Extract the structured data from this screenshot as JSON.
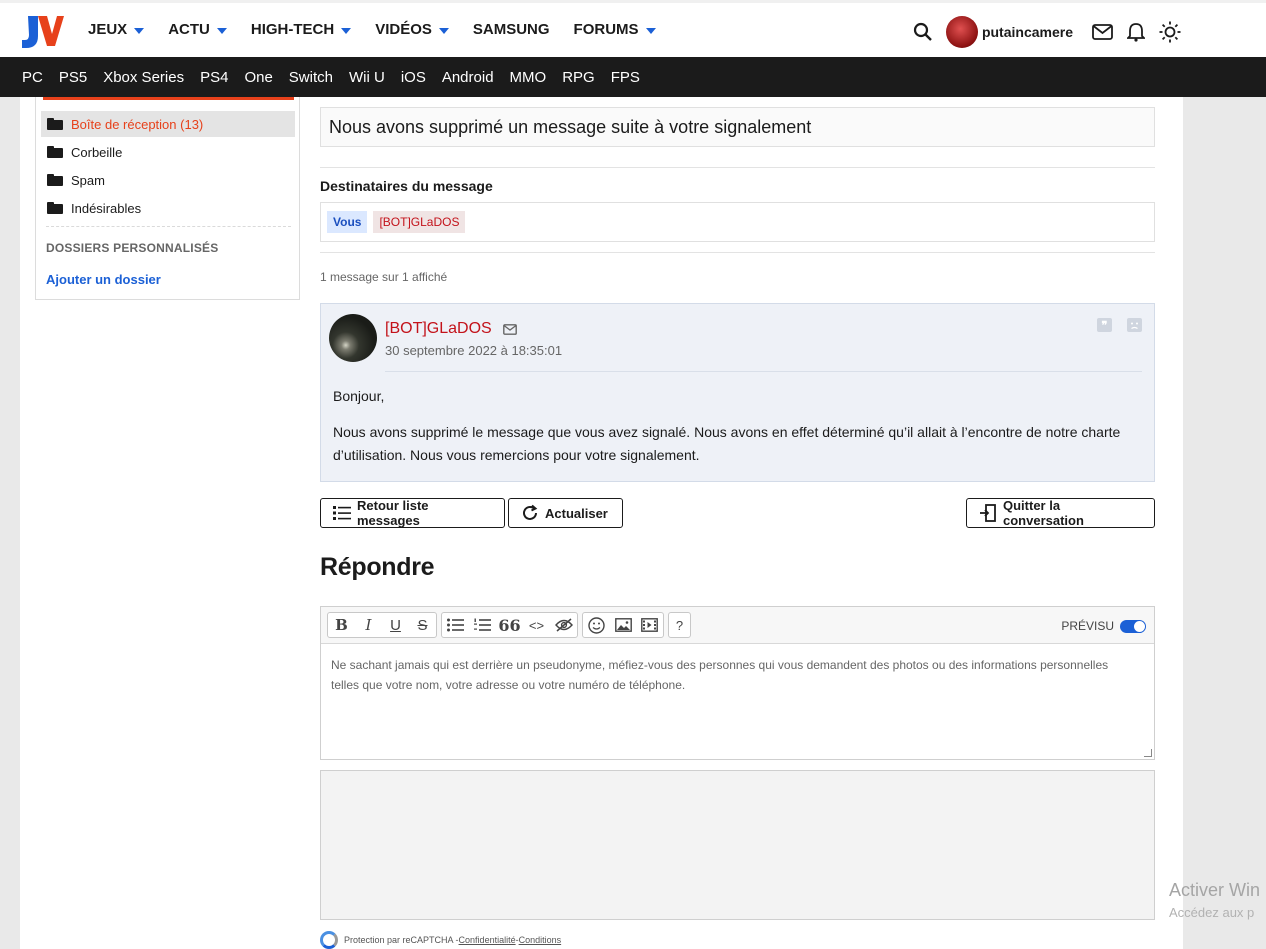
{
  "brand": {
    "logo_text": "JV",
    "accent": "#e7411b",
    "blue": "#1b60d6"
  },
  "topnav": {
    "items": [
      {
        "label": "JEUX",
        "dropdown": true
      },
      {
        "label": "ACTU",
        "dropdown": true
      },
      {
        "label": "HIGH-TECH",
        "dropdown": true
      },
      {
        "label": "VIDÉOS",
        "dropdown": true
      },
      {
        "label": "SAMSUNG",
        "dropdown": false
      },
      {
        "label": "FORUMS",
        "dropdown": true
      }
    ],
    "username": "putaincamere",
    "icons": [
      "search-icon",
      "mail-icon",
      "bell-icon",
      "theme-sun-icon"
    ]
  },
  "subnav": {
    "items": [
      "PC",
      "PS5",
      "Xbox Series",
      "PS4",
      "One",
      "Switch",
      "Wii U",
      "iOS",
      "Android",
      "MMO",
      "RPG",
      "FPS"
    ]
  },
  "sidebar": {
    "folders": [
      {
        "label": "Boîte de réception (13)",
        "active": true
      },
      {
        "label": "Corbeille",
        "active": false
      },
      {
        "label": "Spam",
        "active": false
      },
      {
        "label": "Indésirables",
        "active": false
      }
    ],
    "custom_title": "DOSSIERS PERSONNALISÉS",
    "add_folder": "Ajouter un dossier"
  },
  "conversation": {
    "subject": "Nous avons supprimé un message suite à votre signalement",
    "recipients_title": "Destinataires du message",
    "recipients": [
      "Vous",
      "[BOT]GLaDOS"
    ],
    "count_text": "1 message sur 1 affiché",
    "message": {
      "author": "[BOT]GLaDOS",
      "date": "30 septembre 2022 à 18:35:01",
      "paragraph1": "Bonjour,",
      "paragraph2": "Nous avons supprimé le message que vous avez signalé. Nous avons en effet déterminé qu’il allait à l’encontre de notre charte d’utilisation. Nous vous remercions pour votre signalement."
    },
    "buttons": {
      "back": "Retour liste messages",
      "refresh": "Actualiser",
      "leave": "Quitter la conversation"
    }
  },
  "reply": {
    "title": "Répondre",
    "preview_label": "PRÉVISU",
    "preview_on": true,
    "placeholder": "Ne sachant jamais qui est derrière un pseudonyme, méfiez-vous des personnes qui vous demandent des photos ou des informations personnelles telles que votre nom, votre adresse ou votre numéro de téléphone.",
    "toolbar": {
      "bold": "B",
      "italic": "I",
      "underline": "U",
      "strike": "S",
      "quote": "66",
      "code": "<>",
      "help": "?"
    }
  },
  "recaptcha": {
    "prefix": "Protection par reCAPTCHA - ",
    "privacy": "Confidentialité",
    "separator": " - ",
    "terms": "Conditions"
  },
  "os_watermark": {
    "line1": "Activer Win",
    "line2": "Accédez aux p"
  }
}
